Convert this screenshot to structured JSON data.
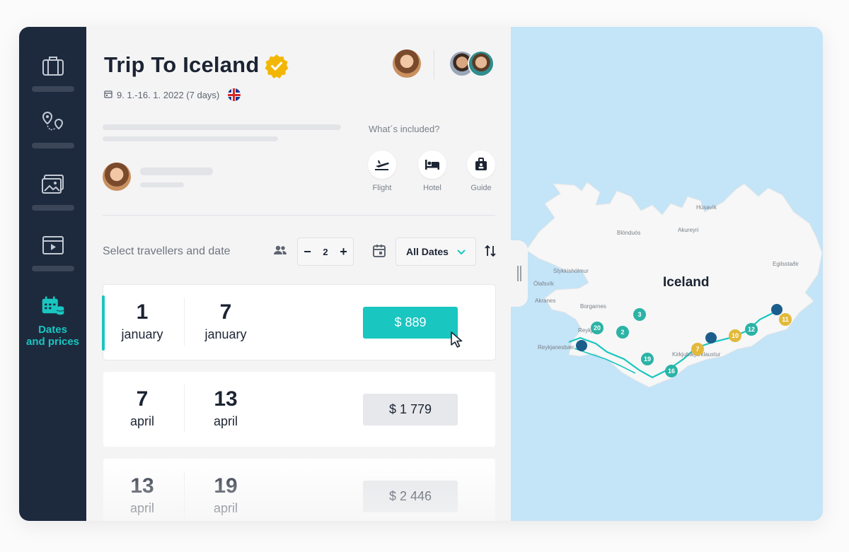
{
  "trip": {
    "title": "Trip To Iceland",
    "dates": "9. 1.-16. 1. 2022 (7 days)"
  },
  "sidebar": {
    "active_label_line1": "Dates",
    "active_label_line2": "and prices"
  },
  "included": {
    "label": "What´s included?",
    "items": [
      "Flight",
      "Hotel",
      "Guide"
    ]
  },
  "selector": {
    "label": "Select travellers and date",
    "travellers": "2",
    "minus": "−",
    "plus": "+",
    "dates_value": "All Dates"
  },
  "date_options": [
    {
      "start_day": "1",
      "start_month": "january",
      "end_day": "7",
      "end_month": "january",
      "price": "$ 889"
    },
    {
      "start_day": "7",
      "start_month": "april",
      "end_day": "13",
      "end_month": "april",
      "price": "$ 1 779"
    },
    {
      "start_day": "13",
      "start_month": "april",
      "end_day": "19",
      "end_month": "april",
      "price": "$ 2 446"
    }
  ],
  "map": {
    "country_label": "Iceland",
    "town_labels": [
      "Reykjavik",
      "Reykjanesbær",
      "Borgarnes",
      "Stykkishólmur",
      "Ólafsvík",
      "Akranes",
      "Blönduós",
      "Akureyri",
      "Húsavík",
      "Egilsstaðir",
      "Kirkjubæjarklaustur"
    ],
    "markers": [
      "20",
      "2",
      "3",
      "19",
      "16",
      "7",
      "10",
      "12",
      "11"
    ]
  },
  "colors": {
    "accent": "#19c6c0",
    "sidebar": "#1d2a3e",
    "map_water": "#c4e4f7",
    "badge": "#f2b705"
  }
}
